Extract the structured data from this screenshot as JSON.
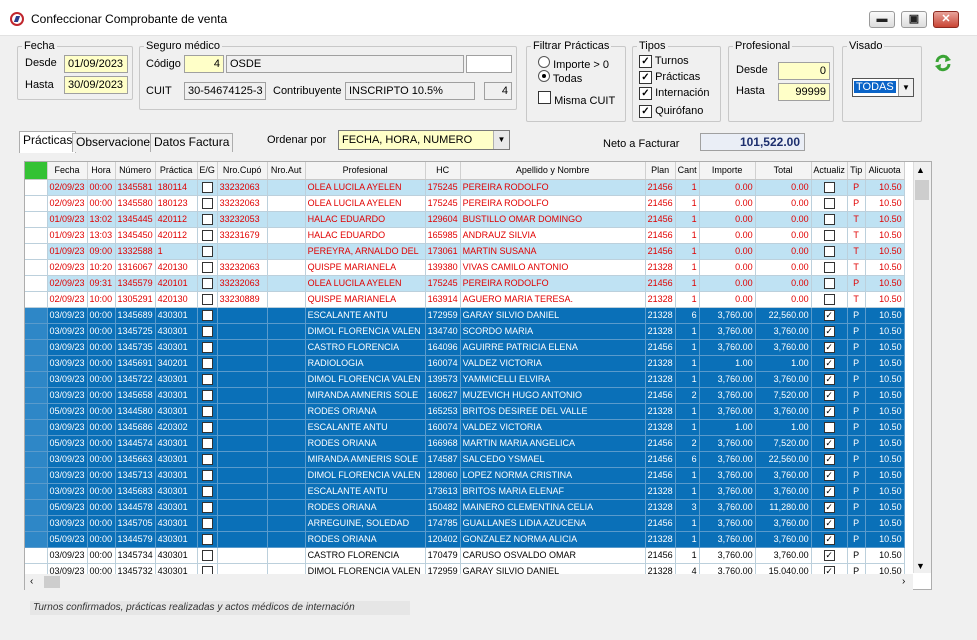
{
  "window": {
    "title": "Confeccionar Comprobante de venta",
    "minimize": "▬",
    "maximize": "▣",
    "close": "✕"
  },
  "fecha": {
    "legend": "Fecha",
    "desde_label": "Desde",
    "desde": "01/09/2023",
    "hasta_label": "Hasta",
    "hasta": "30/09/2023"
  },
  "seguro": {
    "legend": "Seguro médico",
    "codigo_label": "Código",
    "codigo": "4",
    "nombre": "OSDE",
    "cuit_label": "CUIT",
    "cuit": "30-54674125-3",
    "contrib_label": "Contribuyente",
    "contrib": "INSCRIPTO  10.5%",
    "contrib_num": "4"
  },
  "filtrar": {
    "legend": "Filtrar Prácticas",
    "opt1": "Importe > 0",
    "opt2": "Todas",
    "misma": "Misma CUIT"
  },
  "tipos": {
    "legend": "Tipos",
    "items": [
      "Turnos",
      "Prácticas",
      "Internación",
      "Quirófano"
    ]
  },
  "profesional": {
    "legend": "Profesional",
    "desde_label": "Desde",
    "desde": "0",
    "hasta_label": "Hasta",
    "hasta": "99999"
  },
  "visado": {
    "legend": "Visado",
    "value": "TODAS"
  },
  "tabs": [
    "Prácticas",
    "Observaciones",
    "Datos Factura"
  ],
  "ordenar": {
    "label": "Ordenar por",
    "value": "FECHA, HORA, NUMERO"
  },
  "neto": {
    "label": "Neto a Facturar",
    "value": "101,522.00"
  },
  "columns": [
    "Fecha",
    "Hora",
    "Número",
    "Práctica",
    "E/G",
    "Nro.Cupó",
    "Nro.Aut",
    "Profesional",
    "HC",
    "Apellido y Nombre",
    "Plan",
    "Cant",
    "Importe",
    "Total",
    "Actualiz",
    "Tip",
    "Alicuota"
  ],
  "rows": [
    {
      "s": "lb",
      "f": "02/09/23",
      "h": "00:00",
      "n": "1345581",
      "p": "180114",
      "eg": "",
      "c": "33232063",
      "a": "",
      "pr": "OLEA LUCILA AYELEN",
      "hc": "175245",
      "an": "PEREIRA RODOLFO",
      "pl": "21456",
      "q": "1",
      "im": "0.00",
      "t": "0.00",
      "ac": "",
      "ti": "P",
      "al": "10.50"
    },
    {
      "s": "wr",
      "f": "02/09/23",
      "h": "00:00",
      "n": "1345580",
      "p": "180123",
      "eg": "",
      "c": "33232063",
      "a": "",
      "pr": "OLEA LUCILA AYELEN",
      "hc": "175245",
      "an": "PEREIRA RODOLFO",
      "pl": "21456",
      "q": "1",
      "im": "0.00",
      "t": "0.00",
      "ac": "",
      "ti": "P",
      "al": "10.50"
    },
    {
      "s": "lb",
      "f": "01/09/23",
      "h": "13:02",
      "n": "1345445",
      "p": "420112",
      "eg": "",
      "c": "33232053",
      "a": "",
      "pr": "HALAC EDUARDO",
      "hc": "129604",
      "an": "BUSTILLO OMAR DOMINGO",
      "pl": "21456",
      "q": "1",
      "im": "0.00",
      "t": "0.00",
      "ac": "",
      "ti": "T",
      "al": "10.50"
    },
    {
      "s": "wr",
      "f": "01/09/23",
      "h": "13:03",
      "n": "1345450",
      "p": "420112",
      "eg": "",
      "c": "33231679",
      "a": "",
      "pr": "HALAC EDUARDO",
      "hc": "165985",
      "an": "ANDRAUZ SILVIA",
      "pl": "21456",
      "q": "1",
      "im": "0.00",
      "t": "0.00",
      "ac": "",
      "ti": "T",
      "al": "10.50"
    },
    {
      "s": "lb",
      "f": "01/09/23",
      "h": "09:00",
      "n": "1332588",
      "p": "1",
      "eg": "",
      "c": "",
      "a": "",
      "pr": "PEREYRA, ARNALDO DEL",
      "hc": "173061",
      "an": "MARTIN SUSANA",
      "pl": "21456",
      "q": "1",
      "im": "0.00",
      "t": "0.00",
      "ac": "",
      "ti": "T",
      "al": "10.50"
    },
    {
      "s": "wr",
      "f": "02/09/23",
      "h": "10:20",
      "n": "1316067",
      "p": "420130",
      "eg": "",
      "c": "33232063",
      "a": "",
      "pr": "QUISPE MARIANELA",
      "hc": "139380",
      "an": "VIVAS CAMILO ANTONIO",
      "pl": "21328",
      "q": "1",
      "im": "0.00",
      "t": "0.00",
      "ac": "",
      "ti": "T",
      "al": "10.50"
    },
    {
      "s": "lb",
      "f": "02/09/23",
      "h": "09:31",
      "n": "1345579",
      "p": "420101",
      "eg": "",
      "c": "33232063",
      "a": "",
      "pr": "OLEA LUCILA AYELEN",
      "hc": "175245",
      "an": "PEREIRA RODOLFO",
      "pl": "21456",
      "q": "1",
      "im": "0.00",
      "t": "0.00",
      "ac": "",
      "ti": "P",
      "al": "10.50"
    },
    {
      "s": "wr",
      "f": "02/09/23",
      "h": "10:00",
      "n": "1305291",
      "p": "420130",
      "eg": "",
      "c": "33230889",
      "a": "",
      "pr": "QUISPE MARIANELA",
      "hc": "163914",
      "an": "AGUERO MARIA TERESA.",
      "pl": "21328",
      "q": "1",
      "im": "0.00",
      "t": "0.00",
      "ac": "",
      "ti": "T",
      "al": "10.50"
    },
    {
      "s": "sb",
      "f": "03/09/23",
      "h": "00:00",
      "n": "1345689",
      "p": "430301",
      "eg": "",
      "c": "",
      "a": "",
      "pr": "ESCALANTE ANTU",
      "hc": "172959",
      "an": "GARAY SILVIO DANIEL",
      "pl": "21328",
      "q": "6",
      "im": "3,760.00",
      "t": "22,560.00",
      "ac": "✓",
      "ti": "P",
      "al": "10.50"
    },
    {
      "s": "sb",
      "f": "03/09/23",
      "h": "00:00",
      "n": "1345725",
      "p": "430301",
      "eg": "",
      "c": "",
      "a": "",
      "pr": "DIMOL FLORENCIA VALEN",
      "hc": "134740",
      "an": "SCORDO MARIA",
      "pl": "21328",
      "q": "1",
      "im": "3,760.00",
      "t": "3,760.00",
      "ac": "✓",
      "ti": "P",
      "al": "10.50"
    },
    {
      "s": "sb",
      "f": "03/09/23",
      "h": "00:00",
      "n": "1345735",
      "p": "430301",
      "eg": "",
      "c": "",
      "a": "",
      "pr": "CASTRO FLORENCIA",
      "hc": "164096",
      "an": "AGUIRRE PATRICIA ELENA",
      "pl": "21456",
      "q": "1",
      "im": "3,760.00",
      "t": "3,760.00",
      "ac": "✓",
      "ti": "P",
      "al": "10.50"
    },
    {
      "s": "sb",
      "f": "03/09/23",
      "h": "00:00",
      "n": "1345691",
      "p": "340201",
      "eg": "",
      "c": "",
      "a": "",
      "pr": "RADIOLOGIA",
      "hc": "160074",
      "an": "VALDEZ VICTORIA",
      "pl": "21328",
      "q": "1",
      "im": "1.00",
      "t": "1.00",
      "ac": "✓",
      "ti": "P",
      "al": "10.50"
    },
    {
      "s": "sb",
      "f": "03/09/23",
      "h": "00:00",
      "n": "1345722",
      "p": "430301",
      "eg": "",
      "c": "",
      "a": "",
      "pr": "DIMOL FLORENCIA VALEN",
      "hc": "139573",
      "an": "YAMMICELLI ELVIRA",
      "pl": "21328",
      "q": "1",
      "im": "3,760.00",
      "t": "3,760.00",
      "ac": "✓",
      "ti": "P",
      "al": "10.50"
    },
    {
      "s": "sb",
      "f": "03/09/23",
      "h": "00:00",
      "n": "1345658",
      "p": "430301",
      "eg": "",
      "c": "",
      "a": "",
      "pr": "MIRANDA AMNERIS SOLE",
      "hc": "160627",
      "an": "MUZEVICH HUGO ANTONIO",
      "pl": "21456",
      "q": "2",
      "im": "3,760.00",
      "t": "7,520.00",
      "ac": "✓",
      "ti": "P",
      "al": "10.50"
    },
    {
      "s": "sb",
      "f": "05/09/23",
      "h": "00:00",
      "n": "1344580",
      "p": "430301",
      "eg": "",
      "c": "",
      "a": "",
      "pr": "RODES ORIANA",
      "hc": "165253",
      "an": "BRITOS DESIREE DEL VALLE",
      "pl": "21328",
      "q": "1",
      "im": "3,760.00",
      "t": "3,760.00",
      "ac": "✓",
      "ti": "P",
      "al": "10.50"
    },
    {
      "s": "sb",
      "f": "03/09/23",
      "h": "00:00",
      "n": "1345686",
      "p": "420302",
      "eg": "",
      "c": "",
      "a": "",
      "pr": "ESCALANTE ANTU",
      "hc": "160074",
      "an": "VALDEZ VICTORIA",
      "pl": "21328",
      "q": "1",
      "im": "1.00",
      "t": "1.00",
      "ac": "",
      "ti": "P",
      "al": "10.50"
    },
    {
      "s": "sb",
      "f": "05/09/23",
      "h": "00:00",
      "n": "1344574",
      "p": "430301",
      "eg": "",
      "c": "",
      "a": "",
      "pr": "RODES ORIANA",
      "hc": "166968",
      "an": " MARTIN MARIA ANGELICA",
      "pl": "21456",
      "q": "2",
      "im": "3,760.00",
      "t": "7,520.00",
      "ac": "✓",
      "ti": "P",
      "al": "10.50"
    },
    {
      "s": "sb",
      "f": "03/09/23",
      "h": "00:00",
      "n": "1345663",
      "p": "430301",
      "eg": "",
      "c": "",
      "a": "",
      "pr": "MIRANDA AMNERIS SOLE",
      "hc": "174587",
      "an": "SALCEDO YSMAEL",
      "pl": "21456",
      "q": "6",
      "im": "3,760.00",
      "t": "22,560.00",
      "ac": "✓",
      "ti": "P",
      "al": "10.50"
    },
    {
      "s": "sb",
      "f": "03/09/23",
      "h": "00:00",
      "n": "1345713",
      "p": "430301",
      "eg": "",
      "c": "",
      "a": "",
      "pr": "DIMOL FLORENCIA VALEN",
      "hc": "128060",
      "an": "LOPEZ NORMA CRISTINA",
      "pl": "21456",
      "q": "1",
      "im": "3,760.00",
      "t": "3,760.00",
      "ac": "✓",
      "ti": "P",
      "al": "10.50"
    },
    {
      "s": "sb",
      "f": "03/09/23",
      "h": "00:00",
      "n": "1345683",
      "p": "430301",
      "eg": "",
      "c": "",
      "a": "",
      "pr": "ESCALANTE ANTU",
      "hc": "173613",
      "an": "BRITOS MARIA ELENAF",
      "pl": "21328",
      "q": "1",
      "im": "3,760.00",
      "t": "3,760.00",
      "ac": "✓",
      "ti": "P",
      "al": "10.50"
    },
    {
      "s": "sb",
      "f": "05/09/23",
      "h": "00:00",
      "n": "1344578",
      "p": "430301",
      "eg": "",
      "c": "",
      "a": "",
      "pr": "RODES ORIANA",
      "hc": "150482",
      "an": "MAINERO CLEMENTINA CELIA",
      "pl": "21328",
      "q": "3",
      "im": "3,760.00",
      "t": "11,280.00",
      "ac": "✓",
      "ti": "P",
      "al": "10.50"
    },
    {
      "s": "sb",
      "f": "03/09/23",
      "h": "00:00",
      "n": "1345705",
      "p": "430301",
      "eg": "",
      "c": "",
      "a": "",
      "pr": "ARREGUINE, SOLEDAD",
      "hc": "174785",
      "an": "GUALLANES LIDIA AZUCENA",
      "pl": "21456",
      "q": "1",
      "im": "3,760.00",
      "t": "3,760.00",
      "ac": "✓",
      "ti": "P",
      "al": "10.50"
    },
    {
      "s": "sb",
      "f": "05/09/23",
      "h": "00:00",
      "n": "1344579",
      "p": "430301",
      "eg": "",
      "c": "",
      "a": "",
      "pr": "RODES ORIANA",
      "hc": "120402",
      "an": "GONZALEZ NORMA ALICIA",
      "pl": "21328",
      "q": "1",
      "im": "3,760.00",
      "t": "3,760.00",
      "ac": "✓",
      "ti": "P",
      "al": "10.50"
    },
    {
      "s": "wb",
      "f": "03/09/23",
      "h": "00:00",
      "n": "1345734",
      "p": "430301",
      "eg": "",
      "c": "",
      "a": "",
      "pr": "CASTRO FLORENCIA",
      "hc": "170479",
      "an": "CARUSO OSVALDO OMAR",
      "pl": "21456",
      "q": "1",
      "im": "3,760.00",
      "t": "3,760.00",
      "ac": "✓",
      "ti": "P",
      "al": "10.50"
    },
    {
      "s": "wb",
      "f": "03/09/23",
      "h": "00:00",
      "n": "1345732",
      "p": "430301",
      "eg": "",
      "c": "",
      "a": "",
      "pr": "DIMOL FLORENCIA VALEN",
      "hc": "172959",
      "an": "GARAY SILVIO DANIEL",
      "pl": "21328",
      "q": "4",
      "im": "3,760.00",
      "t": "15,040.00",
      "ac": "✓",
      "ti": "P",
      "al": "10.50"
    }
  ],
  "status": "Turnos confirmados, prácticas realizadas y actos médicos de internación"
}
